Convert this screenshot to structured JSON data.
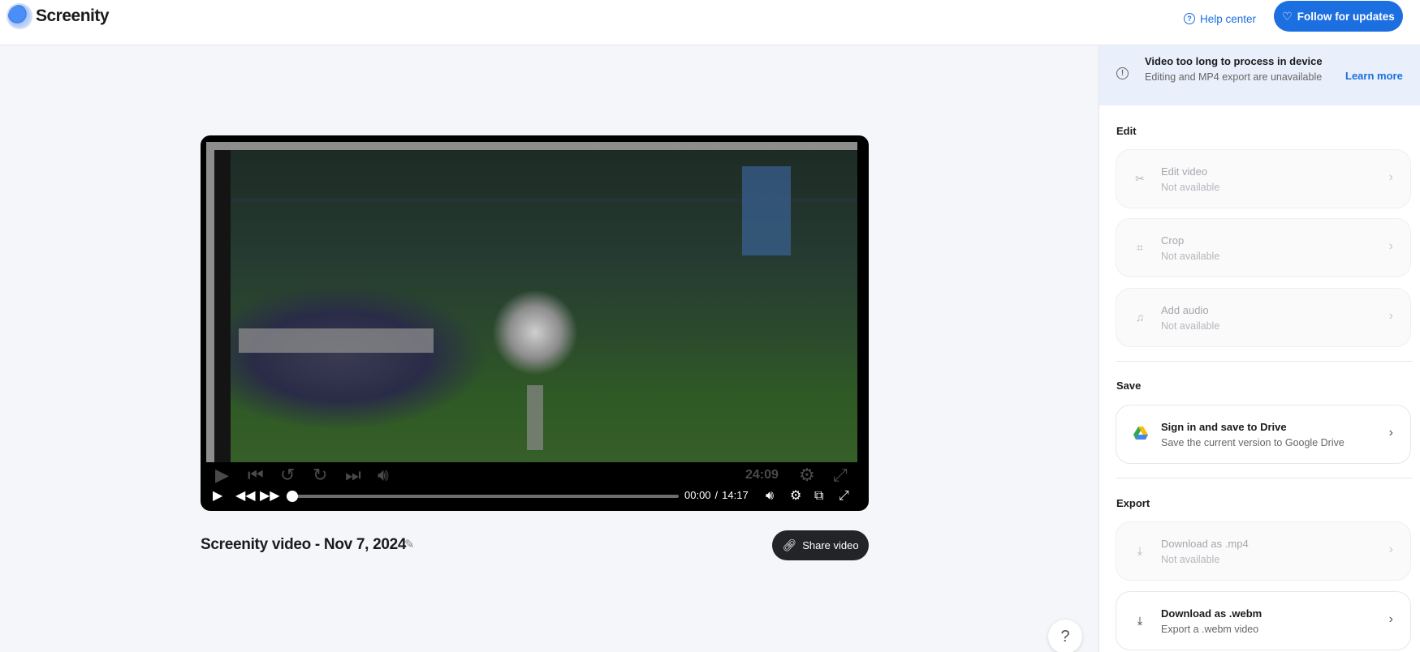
{
  "header": {
    "app_name": "Screenity",
    "help_label": "Help center",
    "follow_label": "Follow for updates"
  },
  "video": {
    "inner_time": "24:09",
    "current_time": "00:00",
    "separator": "/",
    "duration": "14:17",
    "progress": 0,
    "title": "Screenity video - Nov 7, 2024",
    "share_label": "Share video"
  },
  "alert": {
    "title": "Video too long to process in device",
    "body": "Editing and MP4 export are unavailable",
    "link": "Learn more"
  },
  "sections": {
    "edit": "Edit",
    "save": "Save",
    "export": "Export"
  },
  "cards": {
    "edit_video": {
      "title": "Edit video",
      "sub": "Not available"
    },
    "crop": {
      "title": "Crop",
      "sub": "Not available"
    },
    "add_audio": {
      "title": "Add audio",
      "sub": "Not available"
    },
    "drive": {
      "title": "Sign in and save to Drive",
      "sub": "Save the current version to Google Drive"
    },
    "mp4": {
      "title": "Download as .mp4",
      "sub": "Not available"
    },
    "webm": {
      "title": "Download as .webm",
      "sub": "Export a .webm video"
    }
  },
  "help_fab": "?",
  "colors": {
    "accent": "#1c6fe0",
    "alert_bg": "#e9effb",
    "share_bg": "#222428"
  }
}
